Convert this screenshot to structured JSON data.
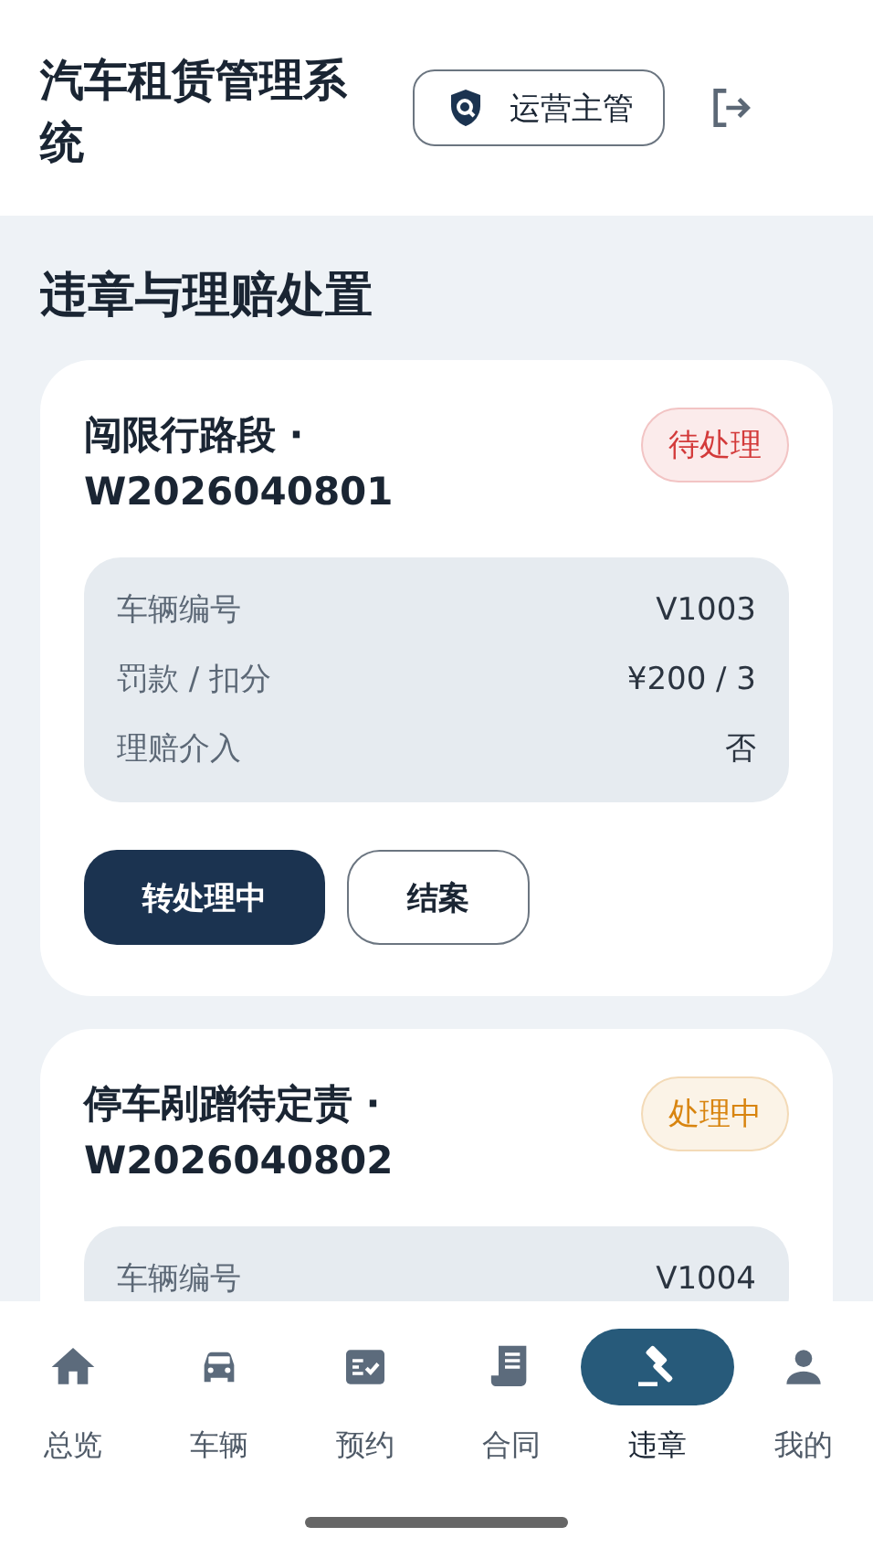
{
  "header": {
    "title": "汽车租赁管理系统",
    "role_button": "运营主管"
  },
  "section_title": "违章与理赔处置",
  "cases": [
    {
      "title": "闯限行路段 · W2026040801",
      "color": "#d33a3a",
      "status_label": "待处理",
      "details": [
        {
          "label": "车辆编号",
          "value": "V1003"
        },
        {
          "label": "罚款 / 扣分",
          "value": "¥200 / 3"
        },
        {
          "label": "理赔介入",
          "value": "否"
        }
      ],
      "actions": [
        {
          "label": "转处理中",
          "kind": "primary"
        },
        {
          "label": "结案",
          "kind": "outline"
        }
      ]
    },
    {
      "title": "停车剐蹭待定责 · W2026040802",
      "color": "#d8840f",
      "status_label": "处理中",
      "details": [
        {
          "label": "车辆编号",
          "value": "V1004"
        }
      ]
    }
  ],
  "nav": [
    {
      "label": "总览",
      "kind": "home",
      "selected": false
    },
    {
      "label": "车辆",
      "kind": "car",
      "selected": false
    },
    {
      "label": "预约",
      "kind": "checklist",
      "selected": false
    },
    {
      "label": "合同",
      "kind": "receipt",
      "selected": false
    },
    {
      "label": "违章",
      "kind": "gavel",
      "selected": true
    },
    {
      "label": "我的",
      "kind": "person",
      "selected": false
    }
  ]
}
